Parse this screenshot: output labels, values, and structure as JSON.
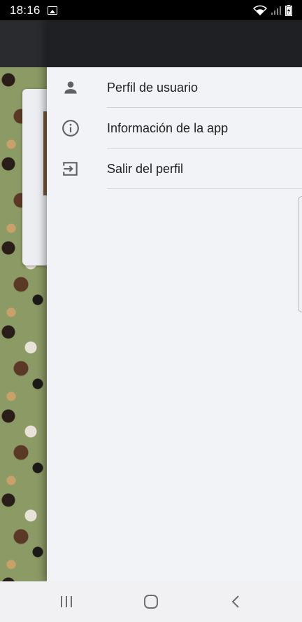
{
  "status_bar": {
    "time": "18:16"
  },
  "drawer": {
    "items": [
      {
        "label": "Perfil de usuario",
        "icon": "person-icon"
      },
      {
        "label": "Información de la app",
        "icon": "info-icon"
      },
      {
        "label": "Salir del perfil",
        "icon": "exit-icon"
      }
    ]
  },
  "colors": {
    "drawer_bg": "#f2f3f7",
    "header_bg": "#1f2023",
    "icon": "#5f6368",
    "text": "#1f1f1f"
  }
}
